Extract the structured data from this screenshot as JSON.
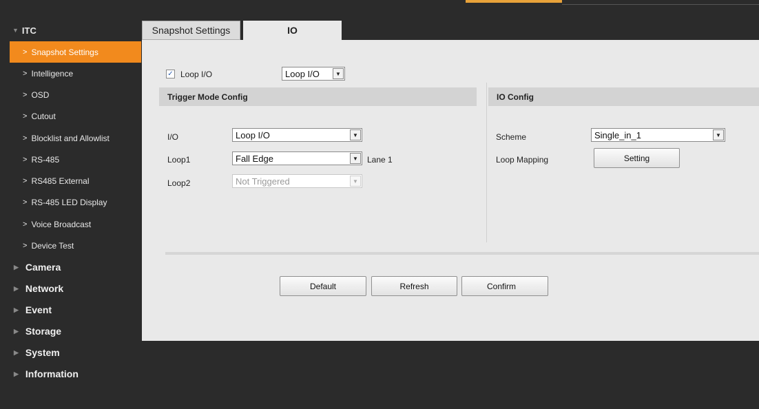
{
  "sidebar": {
    "section_title": "ITC",
    "items": [
      {
        "label": "Snapshot Settings",
        "active": true
      },
      {
        "label": "Intelligence"
      },
      {
        "label": "OSD"
      },
      {
        "label": "Cutout"
      },
      {
        "label": "Blocklist and Allowlist"
      },
      {
        "label": "RS-485"
      },
      {
        "label": "RS485 External"
      },
      {
        "label": "RS-485 LED Display"
      },
      {
        "label": "Voice Broadcast"
      },
      {
        "label": "Device Test"
      }
    ],
    "groups": [
      "Camera",
      "Network",
      "Event",
      "Storage",
      "System",
      "Information"
    ]
  },
  "tabs": [
    {
      "label": "Snapshot Settings",
      "active": false
    },
    {
      "label": "IO",
      "active": true
    }
  ],
  "loop_io": {
    "checkbox_label": "Loop I/O",
    "checked": true,
    "select_value": "Loop I/O"
  },
  "trigger_mode": {
    "title": "Trigger Mode Config",
    "io_label": "I/O",
    "io_value": "Loop I/O",
    "loop1_label": "Loop1",
    "loop1_value": "Fall Edge",
    "loop1_lane": "Lane 1",
    "loop2_label": "Loop2",
    "loop2_value": "Not Triggered"
  },
  "io_config": {
    "title": "IO Config",
    "scheme_label": "Scheme",
    "scheme_value": "Single_in_1",
    "loop_mapping_label": "Loop Mapping",
    "setting_button": "Setting"
  },
  "buttons": {
    "default": "Default",
    "refresh": "Refresh",
    "confirm": "Confirm"
  },
  "colors": {
    "accent": "#f28a1d",
    "sidebar_bg": "#2b2b2b",
    "panel_bg": "#e9e9e9"
  }
}
